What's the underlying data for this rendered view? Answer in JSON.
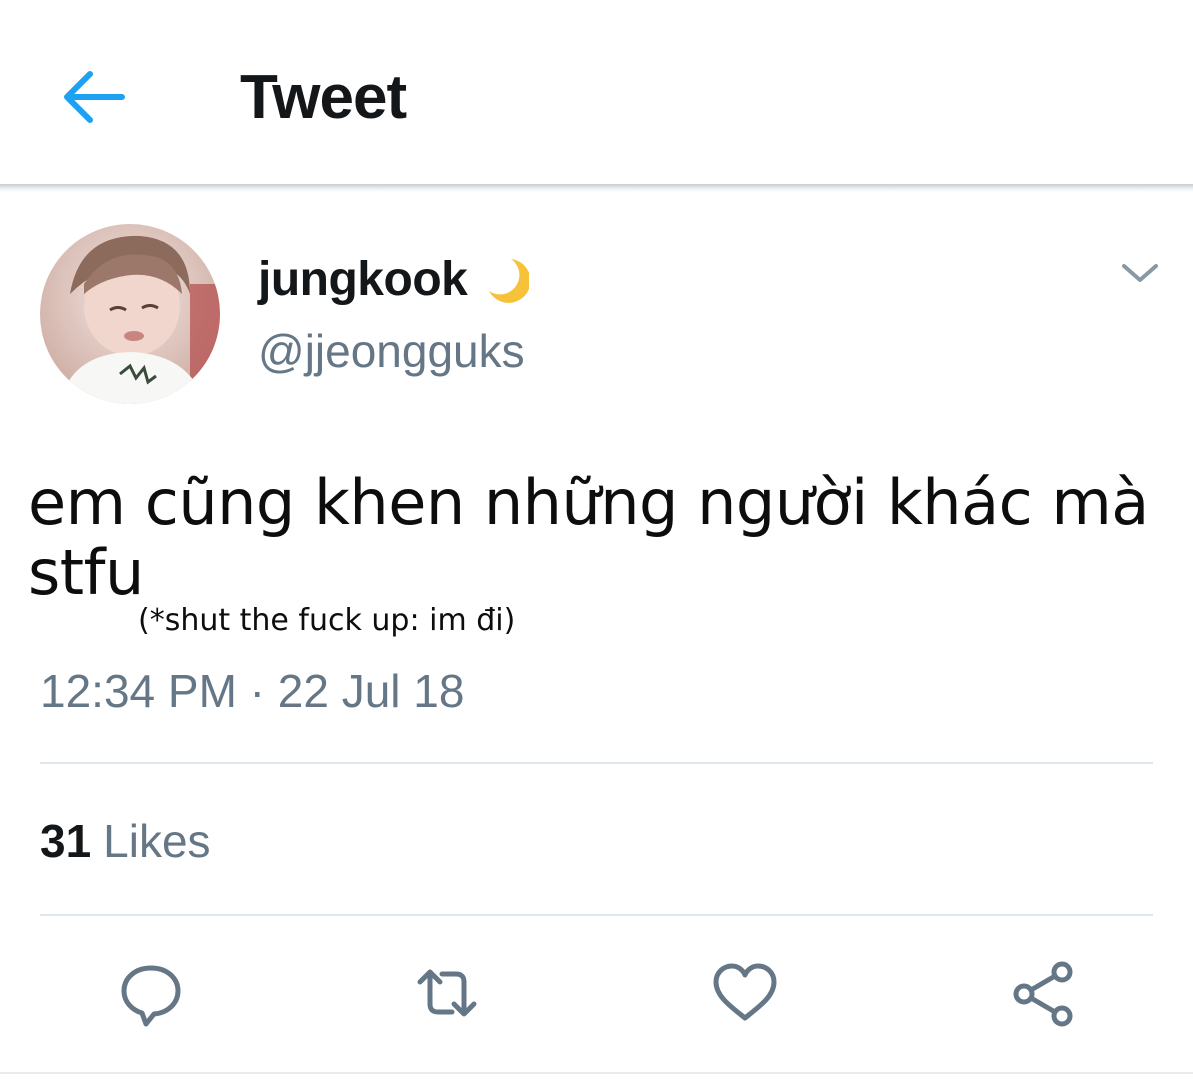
{
  "header": {
    "title": "Tweet",
    "back_icon": "arrow-left-icon",
    "accent_color": "#1da1f2"
  },
  "tweet": {
    "author": {
      "display_name": "jungkook",
      "name_emoji": "crescent-moon-icon",
      "handle": "@jjeongguks"
    },
    "text": "em cũng khen những người khác mà stfu",
    "annotation": "(*shut the fuck up: im đi)",
    "timestamp": "12:34 PM · 22 Jul 18",
    "likes": {
      "count": "31",
      "label": "Likes"
    },
    "actions": [
      {
        "icon": "reply-icon"
      },
      {
        "icon": "retweet-icon"
      },
      {
        "icon": "heart-icon"
      },
      {
        "icon": "share-icon"
      }
    ]
  },
  "colors": {
    "text_primary": "#14171a",
    "text_secondary": "#657786",
    "divider": "#e1e8ed"
  }
}
